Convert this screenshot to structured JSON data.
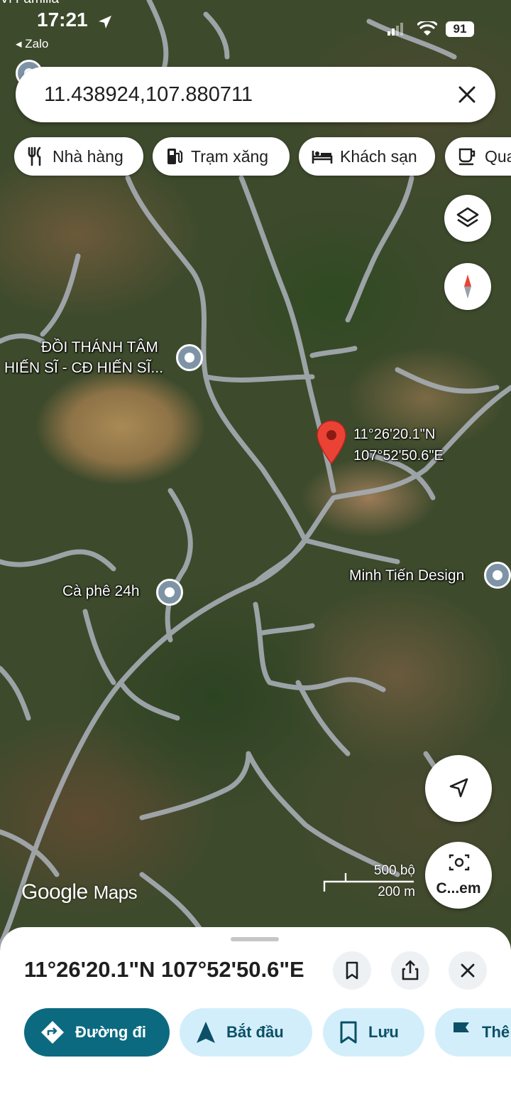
{
  "status_bar": {
    "top_label": "Vi Familia",
    "time": "17:21",
    "back_app": "◂ Zalo",
    "battery": "91"
  },
  "search": {
    "value": "11.438924,107.880711"
  },
  "chips": [
    {
      "label": "Nhà hàng",
      "icon": "restaurant-icon"
    },
    {
      "label": "Trạm xăng",
      "icon": "gas-station-icon"
    },
    {
      "label": "Khách sạn",
      "icon": "hotel-icon"
    },
    {
      "label": "Qua",
      "icon": "coffee-icon"
    }
  ],
  "map": {
    "places": [
      {
        "name": "ĐỒI THÁNH TÂM",
        "name2": "HIẾN SĨ - CĐ HIẾN SĨ...",
        "icon": "church-icon"
      },
      {
        "name": "Cà phê 24h",
        "icon": "place-icon"
      },
      {
        "name": "Minh Tiến Design",
        "icon": "place-icon"
      }
    ],
    "pin": {
      "lat_label": "11°26'20.1\"N",
      "lng_label": "107°52'50.6\"E",
      "color": "#ea4335"
    },
    "camera_label": "C...em",
    "logo": {
      "google": "Google",
      "maps": "Maps"
    },
    "scale": {
      "imperial": "500 bộ",
      "metric": "200 m"
    }
  },
  "sheet": {
    "title": "11°26'20.1\"N 107°52'50.6\"E",
    "actions": [
      {
        "label": "Đường đi",
        "icon": "directions-icon",
        "primary": true
      },
      {
        "label": "Bắt đầu",
        "icon": "navigation-arrow-icon"
      },
      {
        "label": "Lưu",
        "icon": "bookmark-icon"
      },
      {
        "label": "Thê",
        "icon": "flag-icon"
      }
    ]
  },
  "colors": {
    "primary_action": "#0b6a80",
    "secondary_action_bg": "#d3eefb",
    "pin": "#ea4335"
  }
}
